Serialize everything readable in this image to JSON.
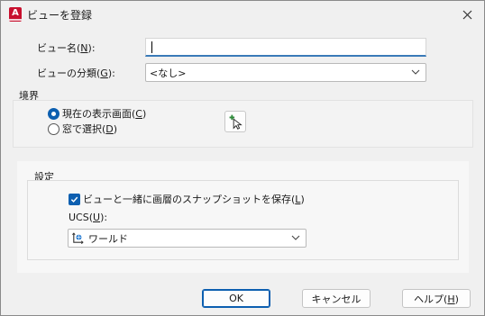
{
  "window": {
    "title": "ビューを登録",
    "app_icon_letter": "A"
  },
  "form": {
    "view_name_label": "ビュー名(",
    "view_name_key": "N",
    "view_name_suffix": "):",
    "view_name_value": "",
    "category_label": "ビューの分類(",
    "category_key": "G",
    "category_suffix": "):",
    "category_value": "<なし>"
  },
  "boundary": {
    "title": "境界",
    "option_current_label": "現在の表示画面(",
    "option_current_key": "C",
    "option_current_suffix": ")",
    "option_current_selected": true,
    "option_window_label": "窓で選択(",
    "option_window_key": "D",
    "option_window_suffix": ")",
    "option_window_selected": false
  },
  "settings": {
    "title": "設定",
    "save_snapshot_label": "ビューと一緒に画層のスナップショットを保存(",
    "save_snapshot_key": "L",
    "save_snapshot_suffix": ")",
    "save_snapshot_checked": true,
    "ucs_label": "UCS(",
    "ucs_key": "U",
    "ucs_suffix": "):",
    "ucs_value": "ワールド"
  },
  "buttons": {
    "ok": "OK",
    "cancel": "キャンセル",
    "help_label": "ヘルプ(",
    "help_key": "H",
    "help_suffix": ")"
  },
  "colors": {
    "accent": "#0d5fb0",
    "app_red": "#c8102e"
  }
}
